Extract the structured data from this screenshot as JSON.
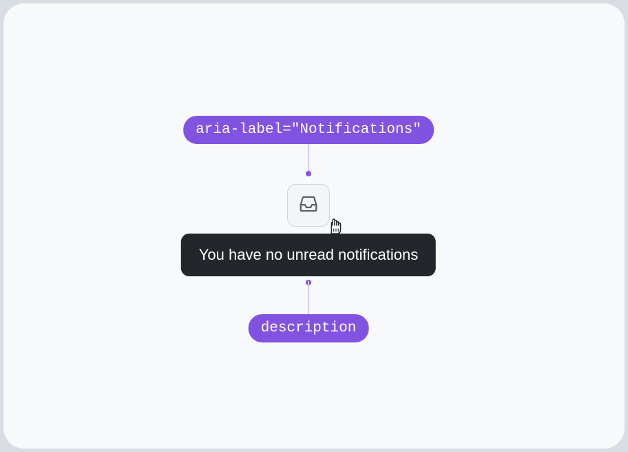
{
  "labels": {
    "aria_label_pill": "aria-label=\"Notifications\"",
    "description_pill": "description"
  },
  "tooltip": {
    "text": "You have no unread notifications"
  },
  "icons": {
    "button": "inbox-icon",
    "cursor": "pointer-cursor-icon"
  },
  "colors": {
    "accent": "#8252e0",
    "tooltip_bg": "#23262b",
    "canvas_bg": "#f7f9fb"
  }
}
